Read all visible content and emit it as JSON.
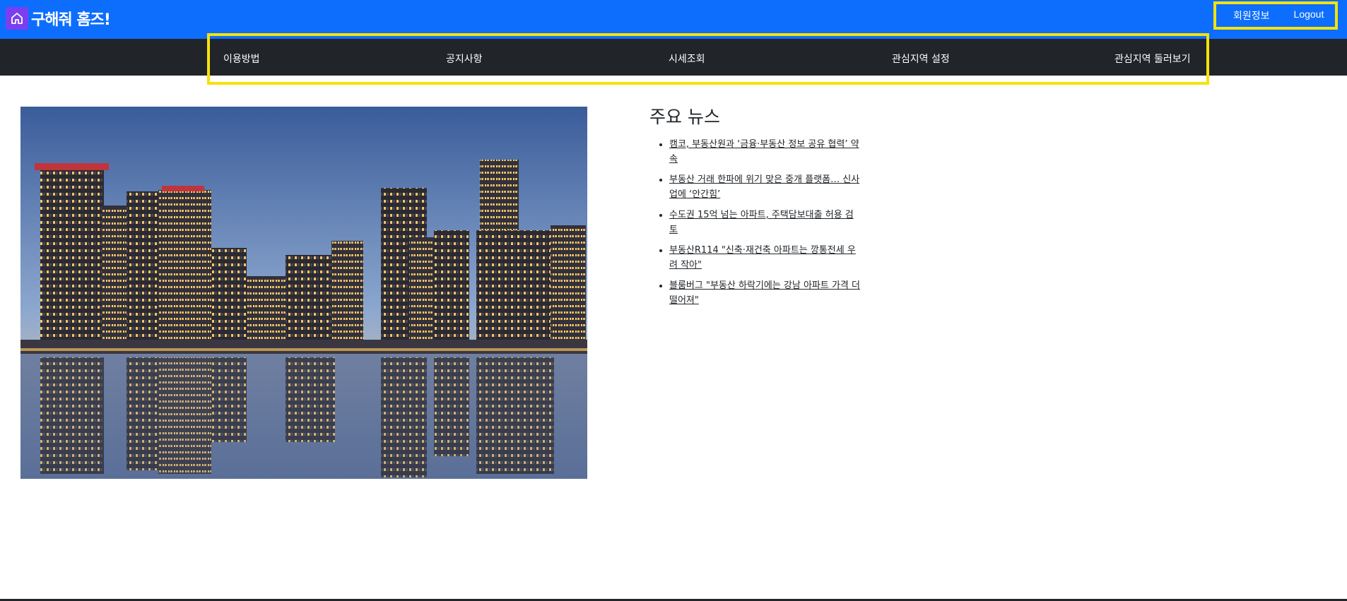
{
  "header": {
    "brand_text": "구해줘 홈즈!",
    "brand_icon": "home-icon",
    "user_menu": {
      "member_info": "회원정보",
      "logout": "Logout"
    }
  },
  "nav": {
    "items": [
      {
        "label": "이용방법"
      },
      {
        "label": "공지사항"
      },
      {
        "label": "시세조회"
      },
      {
        "label": "관심지역 설정"
      },
      {
        "label": "관심지역 둘러보기"
      }
    ]
  },
  "main": {
    "news_title": "주요 뉴스",
    "news": [
      {
        "title": "캠코, 부동산원과 ‘금융·부동산 정보 공유 협력’ 약속"
      },
      {
        "title": "부동산 거래 한파에 위기 맞은 중개 플랫폼… 신사업에 ‘안간힘’"
      },
      {
        "title": "수도권 15억 넘는 아파트, 주택담보대출 허용 검토"
      },
      {
        "title": "부동산R114 \"신축·재건축 아파트는 깡통전세 우려 작아\""
      },
      {
        "title": "블룸버그 \"부동산 하락기에는 강남 아파트 가격 더 떨어져\""
      }
    ]
  },
  "colors": {
    "topbar": "#0d6efd",
    "navbar": "#212529",
    "highlight": "#f4e30a",
    "brand_icon_bg": "#7b3ff2"
  }
}
